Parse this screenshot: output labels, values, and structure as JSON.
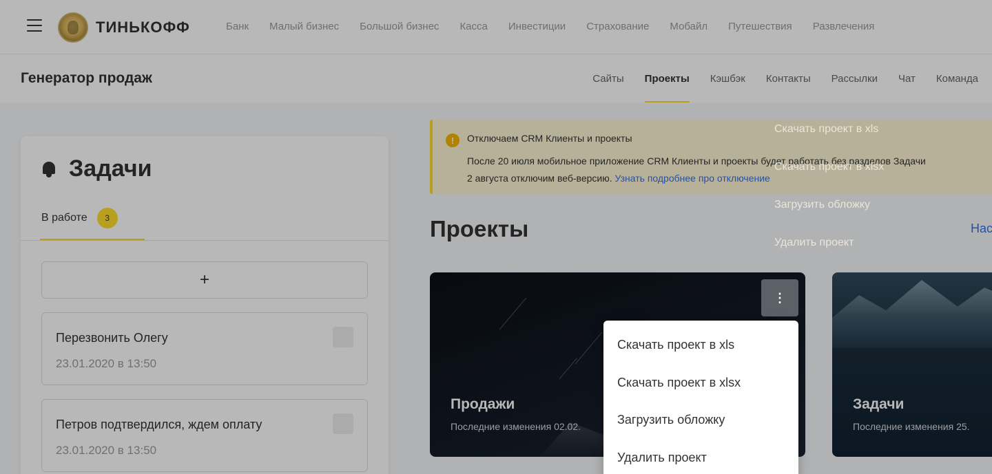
{
  "brand": {
    "name": "ТИНЬКОФФ"
  },
  "top_nav": [
    "Банк",
    "Малый бизнес",
    "Большой бизнес",
    "Касса",
    "Инвестиции",
    "Страхование",
    "Мобайл",
    "Путешествия",
    "Развлечения"
  ],
  "sub_header": {
    "title": "Генератор продаж",
    "nav": [
      "Сайты",
      "Проекты",
      "Кэшбэк",
      "Контакты",
      "Рассылки",
      "Чат",
      "Команда"
    ],
    "active": "Проекты"
  },
  "tasks": {
    "title": "Задачи",
    "tab_label": "В работе",
    "tab_count": "3",
    "add_label": "+",
    "items": [
      {
        "title": "Перезвонить Олегу",
        "date": "23.01.2020 в 13:50"
      },
      {
        "title": "Петров подтвердился, ждем оплату",
        "date": "23.01.2020 в 13:50"
      }
    ]
  },
  "alert": {
    "icon": "!",
    "title": "Отключаем CRM Клиенты и проекты",
    "line1": "После 20 июля мобильное приложение CRM Клиенты и проекты будет работать без разделов Задачи",
    "line2_prefix": "2 августа отключим веб-версию. ",
    "link": "Узнать подробнее про отключение"
  },
  "projects": {
    "heading": "Проекты",
    "settings_link": "Нас",
    "cards": [
      {
        "name": "Продажи",
        "updated": "Последние изменения 02.02."
      },
      {
        "name": "Задачи",
        "updated": "Последние изменения 25."
      }
    ]
  },
  "menu_button_icon": "⋮",
  "context_menu": [
    "Скачать проект в xls",
    "Скачать проект в xlsx",
    "Загрузить обложку",
    "Удалить проект"
  ],
  "colors": {
    "accent": "#ffdd2d",
    "link": "#336fee",
    "alert_bg": "#fff6d5"
  }
}
